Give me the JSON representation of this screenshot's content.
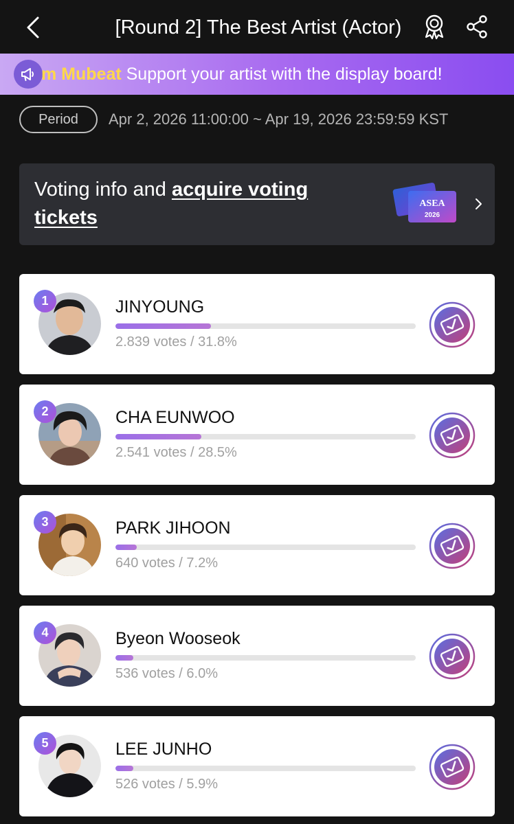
{
  "header": {
    "title": "[Round 2] The Best Artist (Actor)"
  },
  "banner": {
    "brand": "m Mubeat",
    "message": " Support your artist with the display board!"
  },
  "period": {
    "label": "Period",
    "range": "Apr 2, 2026 11:00:00 ~ Apr 19, 2026 23:59:59 KST"
  },
  "info_card": {
    "text": "Voting info and ",
    "link": "acquire voting tickets",
    "ticket_logo": "ASEA",
    "ticket_year": "2026"
  },
  "colors": {
    "accent": "#a86af0",
    "brand_yellow": "#ffd84a",
    "bar_fill": "#b675d6"
  },
  "rankings": [
    {
      "rank": "1",
      "name": "JINYOUNG",
      "votes": "2.839 votes / 31.8%",
      "share": 0.318
    },
    {
      "rank": "2",
      "name": "CHA EUNWOO",
      "votes": "2.541 votes / 28.5%",
      "share": 0.285
    },
    {
      "rank": "3",
      "name": "PARK JIHOON",
      "votes": "640 votes / 7.2%",
      "share": 0.072
    },
    {
      "rank": "4",
      "name": "Byeon Wooseok",
      "votes": "536 votes / 6.0%",
      "share": 0.06
    },
    {
      "rank": "5",
      "name": "LEE JUNHO",
      "votes": "526 votes / 5.9%",
      "share": 0.059
    }
  ]
}
